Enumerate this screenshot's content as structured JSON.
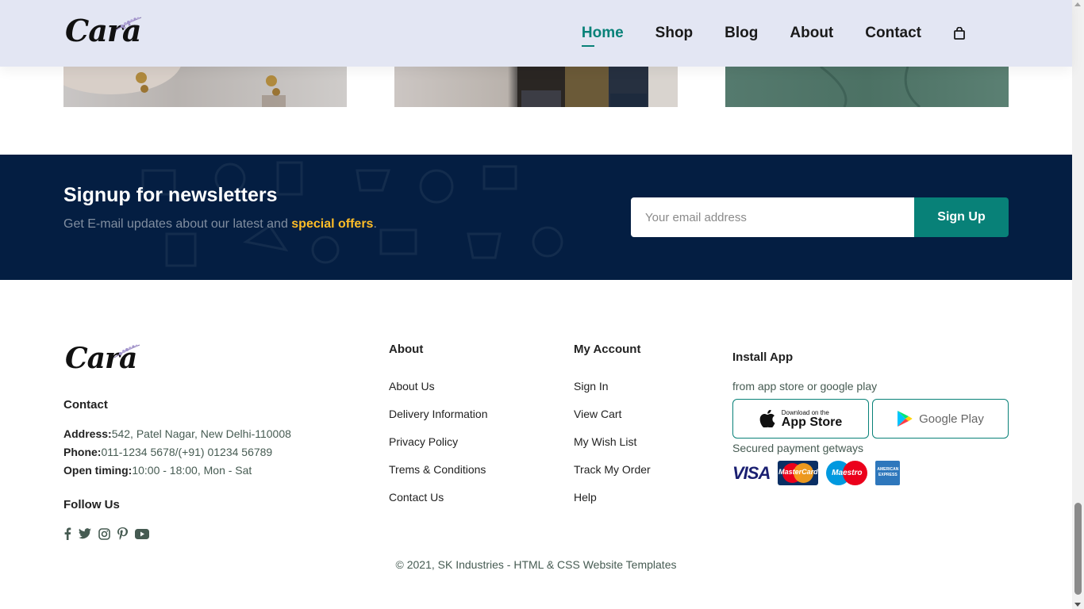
{
  "header": {
    "logo_text": "Cara",
    "nav": [
      {
        "label": "Home",
        "active": true
      },
      {
        "label": "Shop",
        "active": false
      },
      {
        "label": "Blog",
        "active": false
      },
      {
        "label": "About",
        "active": false
      },
      {
        "label": "Contact",
        "active": false
      }
    ],
    "cart_icon": "shopping-bag-icon"
  },
  "newsletter": {
    "title": "Signup for newsletters",
    "subtitle_prefix": "Get E-mail updates about our latest and ",
    "subtitle_highlight": "special offers",
    "subtitle_suffix": ".",
    "email_placeholder": "Your email address",
    "button_label": "Sign Up"
  },
  "footer": {
    "logo_text": "Cara",
    "contact": {
      "heading": "Contact",
      "address_label": "Address:",
      "address_value": "542, Patel Nagar, New Delhi-110008",
      "phone_label": "Phone:",
      "phone_value": "011-1234 5678/(+91) 01234 56789",
      "timing_label": "Open timing:",
      "timing_value": "10:00 - 18:00, Mon - Sat"
    },
    "follow": {
      "heading": "Follow Us",
      "icons": [
        "facebook-icon",
        "twitter-icon",
        "instagram-icon",
        "pinterest-icon",
        "youtube-icon"
      ]
    },
    "about": {
      "heading": "About",
      "links": [
        "About Us",
        "Delivery Information",
        "Privacy Policy",
        "Trems & Conditions",
        "Contact Us"
      ]
    },
    "account": {
      "heading": "My Account",
      "links": [
        "Sign In",
        "View Cart",
        "My Wish List",
        "Track My Order",
        "Help"
      ]
    },
    "install": {
      "heading": "Install App",
      "subtitle": "from app store or google play",
      "appstore_small": "Download on the",
      "appstore_big": "App Store",
      "googleplay": "Google Play",
      "payment_label": "Secured payment getways",
      "visa": "VISA",
      "mastercard": "MasterCard",
      "maestro": "Maestro",
      "amex": "AMERICAN EXPRESS"
    },
    "copyright": "© 2021, SK Industries - HTML & CSS Website Templates"
  },
  "colors": {
    "accent": "#088178",
    "header_bg": "#e3e6f3",
    "newsletter_bg": "#041e42",
    "highlight": "#ffbd27"
  }
}
